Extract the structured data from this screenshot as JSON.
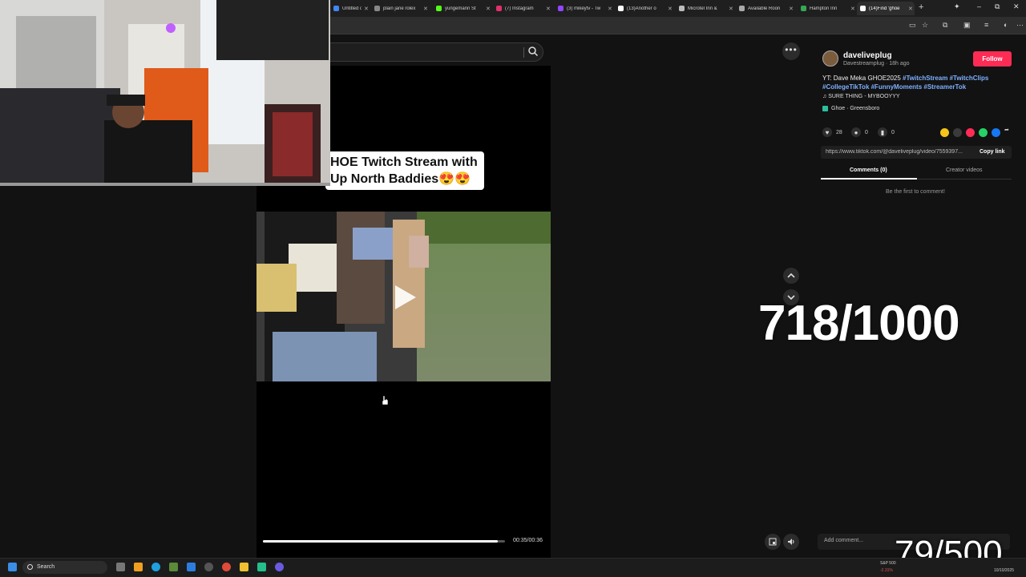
{
  "browser": {
    "tabs": [
      {
        "label": "Untitled document",
        "color": "#4285f4"
      },
      {
        "label": "plain jane rolex",
        "color": "#888888"
      },
      {
        "label": "yungemann St",
        "color": "#53fc18"
      },
      {
        "label": "(7) Instagram",
        "color": "#e1306c"
      },
      {
        "label": "(3) mikeytv - Tw",
        "color": "#9146ff"
      },
      {
        "label": "(13)Another o",
        "color": "#ffffff"
      },
      {
        "label": "Microtel Inn &",
        "color": "#bbbbbb"
      },
      {
        "label": "Available Roon",
        "color": "#aaaaaa"
      },
      {
        "label": "Hampton Inn",
        "color": "#34a853"
      },
      {
        "label": "(14)Find 'ghoe",
        "color": "#ffffff"
      }
    ],
    "new_tab": "+",
    "window_controls": {
      "minimize": "–",
      "maximize": "⧉",
      "close": "✕"
    }
  },
  "search": {
    "icon": "search-icon"
  },
  "video": {
    "caption_line1": "HOE Twitch Stream with",
    "caption_line2": "Up North Baddies😍😍",
    "time": "00:35/00:36",
    "progress": 0.97
  },
  "counters": {
    "big": "718/1000",
    "small": "79/500"
  },
  "post": {
    "username": "daveliveplug",
    "subline": "Davestreamplug · 18h ago",
    "follow": "Follow",
    "description_text": "YT: Dave Meka GHOE2025 ",
    "description_tags": "#TwitchStream #TwitchClips #CollegeTikTok #FunnyMoments #StreamerTok",
    "music": "SURE THING - MYBOOYYY",
    "location": "Ghoe · Greensboro",
    "likes": "28",
    "comments": "0",
    "saves": "0",
    "link": "https://www.tiktok.com/@daveliveplug/video/7559397...",
    "copy_link": "Copy link",
    "tab_comments": "Comments (0)",
    "tab_creator": "Creator videos",
    "empty_comments": "Be the first to comment!",
    "add_comment": "Add comment...",
    "share_colors": [
      "#f5c518",
      "#3a3a3a",
      "#fe2c55",
      "#25d366",
      "#1877f2"
    ]
  },
  "taskbar": {
    "search": "Search",
    "stock": "S&P 500",
    "stock_change": "-2.31%",
    "date": "10/10/2025"
  }
}
